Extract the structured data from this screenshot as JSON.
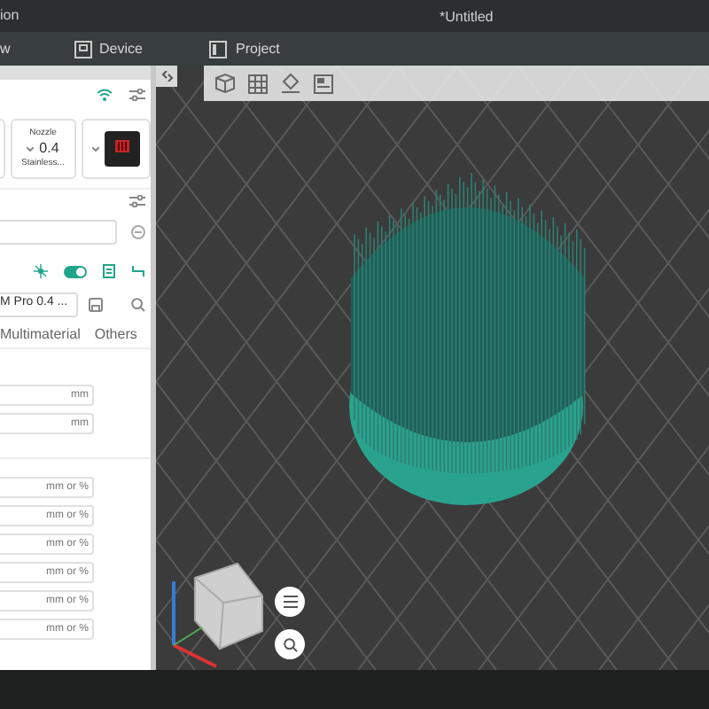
{
  "title_bar": {
    "app_name_fragment": "ion",
    "document_title": "*Untitled"
  },
  "menu": [
    {
      "label": "w",
      "kind": "plain"
    },
    {
      "label": "Device",
      "kind": "device"
    },
    {
      "label": "Project",
      "kind": "project"
    }
  ],
  "printer": {
    "nozzle": {
      "label": "Nozzle",
      "value": "0.4",
      "material": "Stainless..."
    }
  },
  "process": {
    "preset": "M Pro 0.4 ...",
    "advanced": true,
    "tabs": [
      {
        "label": "Multimaterial",
        "selected": false
      },
      {
        "label": "Others",
        "selected": false
      }
    ]
  },
  "settings": {
    "groups": [
      {
        "rows": [
          {
            "unit": "mm"
          },
          {
            "unit": "mm"
          }
        ]
      },
      {
        "rows": [
          {
            "unit": "mm or %"
          },
          {
            "unit": "mm or %"
          },
          {
            "unit": "mm or %"
          },
          {
            "unit": "mm or %"
          },
          {
            "unit": "mm or %"
          },
          {
            "unit": "mm or %"
          }
        ]
      }
    ]
  }
}
